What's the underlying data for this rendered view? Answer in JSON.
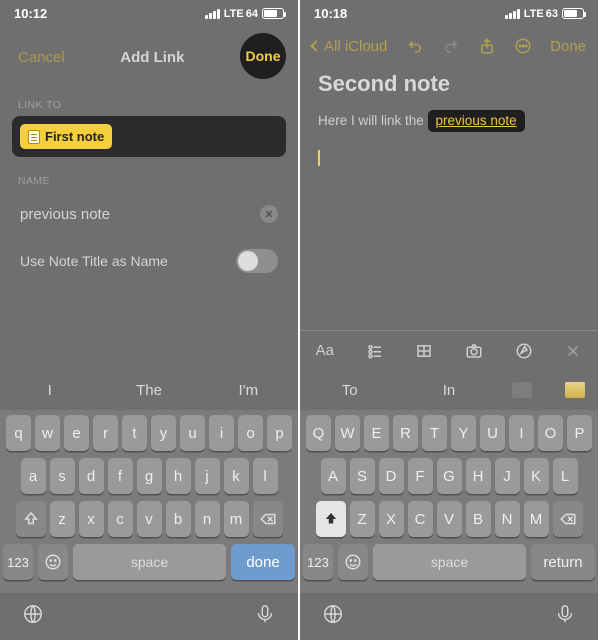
{
  "left": {
    "status": {
      "time": "10:12",
      "net": "LTE",
      "battery": 64
    },
    "nav": {
      "cancel": "Cancel",
      "title": "Add Link",
      "done": "Done"
    },
    "sections": {
      "linkto_label": "LINK TO",
      "linkto_chip": "First note",
      "name_label": "NAME",
      "name_value": "previous note",
      "toggle_label": "Use Note Title as Name"
    },
    "suggestions": [
      "I",
      "The",
      "I'm"
    ],
    "keyboard": {
      "rows": [
        [
          "q",
          "w",
          "e",
          "r",
          "t",
          "y",
          "u",
          "i",
          "o",
          "p"
        ],
        [
          "a",
          "s",
          "d",
          "f",
          "g",
          "h",
          "j",
          "k",
          "l"
        ],
        [
          "z",
          "x",
          "c",
          "v",
          "b",
          "n",
          "m"
        ]
      ],
      "num": "123",
      "space": "space",
      "action": "done"
    }
  },
  "right": {
    "status": {
      "time": "10:18",
      "net": "LTE",
      "battery": 63
    },
    "nav": {
      "back": "All iCloud",
      "done": "Done"
    },
    "note": {
      "title": "Second note",
      "body_prefix": "Here I will link the ",
      "link_text": "previous note"
    },
    "suggestions": [
      "To",
      "In"
    ],
    "fmt": {
      "aa": "Aa"
    },
    "keyboard": {
      "rows": [
        [
          "Q",
          "W",
          "E",
          "R",
          "T",
          "Y",
          "U",
          "I",
          "O",
          "P"
        ],
        [
          "A",
          "S",
          "D",
          "F",
          "G",
          "H",
          "J",
          "K",
          "L"
        ],
        [
          "Z",
          "X",
          "C",
          "V",
          "B",
          "N",
          "M"
        ]
      ],
      "num": "123",
      "space": "space",
      "action": "return"
    }
  }
}
